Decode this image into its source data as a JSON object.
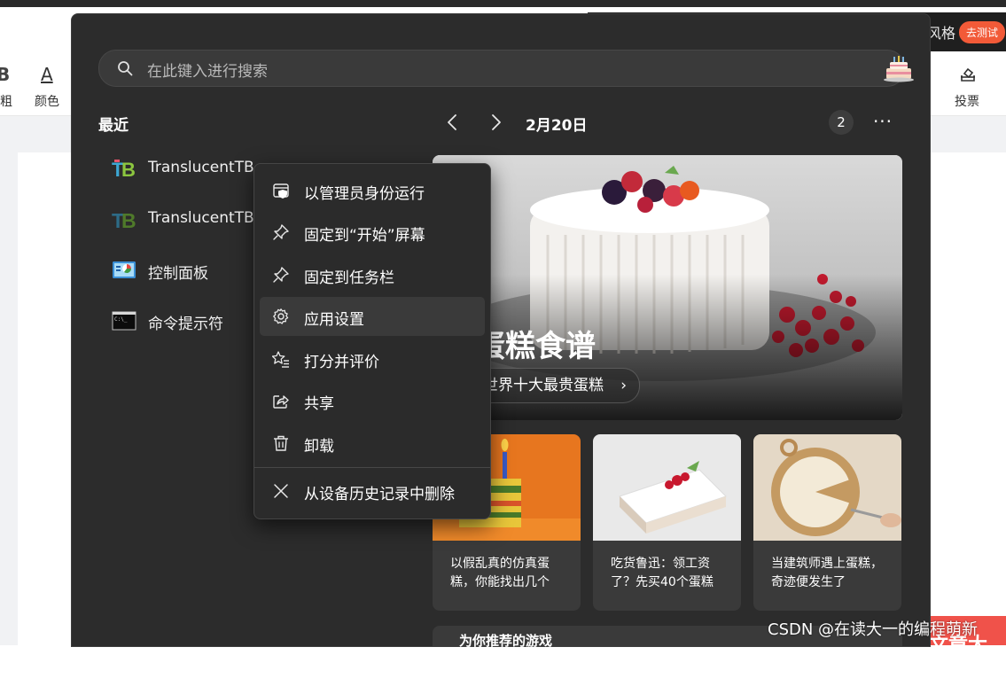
{
  "background": {
    "left_bold_glyph": "B",
    "left_label": "粗",
    "color_glyph": "A",
    "color_label": "颜色",
    "style_text": "风格",
    "test_button": "去测试",
    "vote_label": "投票",
    "orange_text": "文章大赛",
    "watermark": "CSDN @在读大一的编程萌新"
  },
  "search": {
    "placeholder": "在此键入进行搜索"
  },
  "recent": {
    "title": "最近",
    "items": [
      {
        "label": "TranslucentTB",
        "icon": "translucenttb-icon"
      },
      {
        "label": "TranslucentTB",
        "icon": "translucenttb-icon"
      },
      {
        "label": "控制面板",
        "icon": "control-panel-icon"
      },
      {
        "label": "命令提示符",
        "icon": "command-prompt-icon"
      }
    ]
  },
  "highlights": {
    "date": "2月20日",
    "count": "2",
    "more": "···",
    "hero": {
      "title": "蛋糕食谱",
      "link": "世界十大最贵蛋糕"
    },
    "cards": [
      {
        "caption": "以假乱真的仿真蛋糕，你能找出几个"
      },
      {
        "caption": "吃货鲁迅：领工资了？先买40个蛋糕"
      },
      {
        "caption": "当建筑师遇上蛋糕，奇迹便发生了"
      }
    ],
    "bottom_text": "为你推荐的游戏"
  },
  "context_menu": {
    "items": [
      {
        "label": "以管理员身份运行",
        "icon": "shield-run-icon"
      },
      {
        "label": "固定到“开始”屏幕",
        "icon": "pin-icon"
      },
      {
        "label": "固定到任务栏",
        "icon": "pin-icon"
      },
      {
        "label": "应用设置",
        "icon": "gear-icon"
      },
      {
        "label": "打分并评价",
        "icon": "star-list-icon"
      },
      {
        "label": "共享",
        "icon": "share-icon"
      },
      {
        "label": "卸载",
        "icon": "trash-icon"
      },
      {
        "label": "从设备历史记录中删除",
        "icon": "close-icon"
      }
    ],
    "hovered_item": "应用设置"
  },
  "colors": {
    "panel_bg": "#2c2c2c",
    "menu_bg": "#2b2b2b",
    "accent_orange": "#f25a38"
  }
}
